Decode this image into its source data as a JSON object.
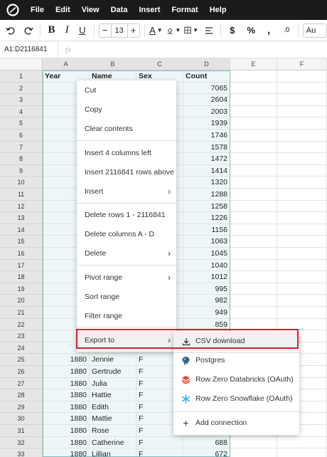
{
  "menubar": {
    "items": [
      "File",
      "Edit",
      "View",
      "Data",
      "Insert",
      "Format",
      "Help"
    ]
  },
  "toolbar": {
    "font_size": "13",
    "font_name": "Au"
  },
  "formula_bar": {
    "cell_ref": "A1:D2116841",
    "fx_label": "fx",
    "value": ""
  },
  "grid": {
    "columns": [
      "A",
      "B",
      "C",
      "D",
      "E",
      "F"
    ],
    "rows": [
      {
        "num": "1",
        "a": "Year",
        "b": "Name",
        "c": "Sex",
        "d": "Count"
      },
      {
        "num": "2",
        "a": "18",
        "b": "",
        "c": "",
        "d": "7065"
      },
      {
        "num": "3",
        "a": "18",
        "b": "",
        "c": "",
        "d": "2604"
      },
      {
        "num": "4",
        "a": "18",
        "b": "",
        "c": "",
        "d": "2003"
      },
      {
        "num": "5",
        "a": "18",
        "b": "",
        "c": "",
        "d": "1939"
      },
      {
        "num": "6",
        "a": "18",
        "b": "",
        "c": "",
        "d": "1746"
      },
      {
        "num": "7",
        "a": "18",
        "b": "",
        "c": "",
        "d": "1578"
      },
      {
        "num": "8",
        "a": "18",
        "b": "",
        "c": "",
        "d": "1472"
      },
      {
        "num": "9",
        "a": "18",
        "b": "",
        "c": "",
        "d": "1414"
      },
      {
        "num": "10",
        "a": "18",
        "b": "",
        "c": "",
        "d": "1320"
      },
      {
        "num": "11",
        "a": "18",
        "b": "",
        "c": "",
        "d": "1288"
      },
      {
        "num": "12",
        "a": "18",
        "b": "",
        "c": "",
        "d": "1258"
      },
      {
        "num": "13",
        "a": "18",
        "b": "",
        "c": "",
        "d": "1226"
      },
      {
        "num": "14",
        "a": "18",
        "b": "",
        "c": "",
        "d": "1156"
      },
      {
        "num": "15",
        "a": "18",
        "b": "",
        "c": "",
        "d": "1063"
      },
      {
        "num": "16",
        "a": "18",
        "b": "",
        "c": "",
        "d": "1045"
      },
      {
        "num": "17",
        "a": "18",
        "b": "",
        "c": "",
        "d": "1040"
      },
      {
        "num": "18",
        "a": "18",
        "b": "",
        "c": "",
        "d": "1012"
      },
      {
        "num": "19",
        "a": "18",
        "b": "",
        "c": "",
        "d": "995"
      },
      {
        "num": "20",
        "a": "18",
        "b": "",
        "c": "",
        "d": "982"
      },
      {
        "num": "21",
        "a": "18",
        "b": "",
        "c": "",
        "d": "949"
      },
      {
        "num": "22",
        "a": "18",
        "b": "",
        "c": "",
        "d": "859"
      },
      {
        "num": "23",
        "a": "18",
        "b": "",
        "c": "",
        "d": ""
      },
      {
        "num": "24",
        "a": "18",
        "b": "",
        "c": "",
        "d": ""
      },
      {
        "num": "25",
        "a": "1880",
        "b": "Jennie",
        "c": "F",
        "d": ""
      },
      {
        "num": "26",
        "a": "1880",
        "b": "Gertrude",
        "c": "F",
        "d": ""
      },
      {
        "num": "27",
        "a": "1880",
        "b": "Julia",
        "c": "F",
        "d": ""
      },
      {
        "num": "28",
        "a": "1880",
        "b": "Hattie",
        "c": "F",
        "d": ""
      },
      {
        "num": "29",
        "a": "1880",
        "b": "Edith",
        "c": "F",
        "d": ""
      },
      {
        "num": "30",
        "a": "1880",
        "b": "Mattie",
        "c": "F",
        "d": ""
      },
      {
        "num": "31",
        "a": "1880",
        "b": "Rose",
        "c": "F",
        "d": ""
      },
      {
        "num": "32",
        "a": "1880",
        "b": "Catherine",
        "c": "F",
        "d": "688"
      },
      {
        "num": "33",
        "a": "1880",
        "b": "Lillian",
        "c": "F",
        "d": "672"
      }
    ]
  },
  "context_menu": {
    "cut": "Cut",
    "copy": "Copy",
    "clear": "Clear contents",
    "insert_cols": "Insert 4 columns left",
    "insert_rows": "Insert 2116841 rows above",
    "insert": "Insert",
    "delete_rows": "Delete rows 1 - 2116841",
    "delete_cols": "Delete columns A - D",
    "delete": "Delete",
    "pivot": "Pivot range",
    "sort": "Sort range",
    "filter": "Filter range",
    "export": "Export to"
  },
  "export_submenu": {
    "csv": "CSV download",
    "postgres": "Postgres",
    "databricks": "Row Zero Databricks (OAuth)",
    "snowflake": "Row Zero Snowflake (OAuth)",
    "add": "Add connection"
  },
  "colors": {
    "highlight_border": "#e01b2e",
    "selection_fill": "#eef7f7",
    "menubar_bg": "#1b1b1b"
  }
}
